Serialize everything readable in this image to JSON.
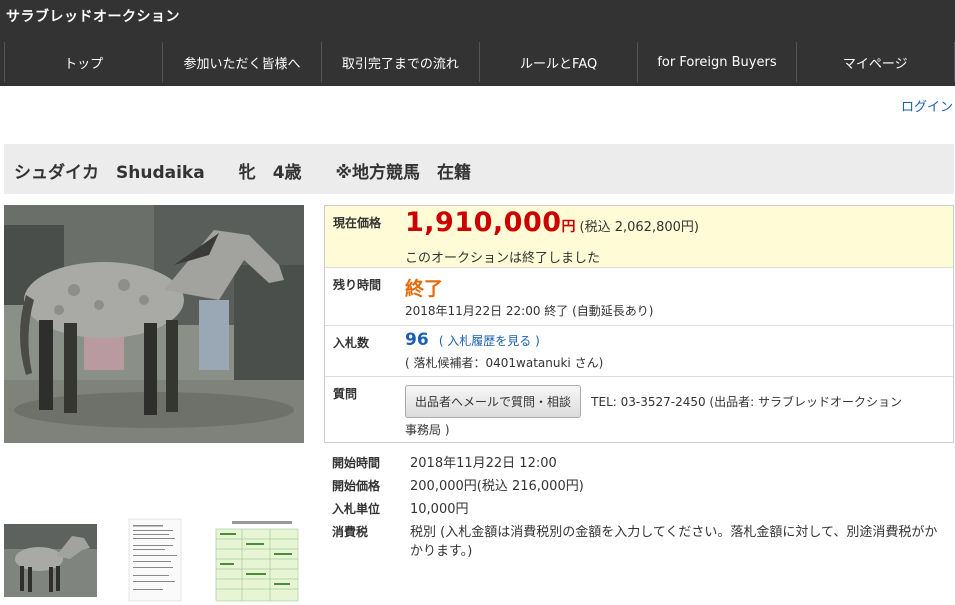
{
  "header": {
    "site_title": "サラブレッドオークション",
    "nav": [
      "トップ",
      "参加いただく皆様へ",
      "取引完了までの流れ",
      "ルールとFAQ",
      "for Foreign Buyers",
      "マイページ"
    ],
    "login": "ログイン"
  },
  "item": {
    "title": "シュダイカ　Shudaika　　牝　4歳　　※地方競馬　在籍"
  },
  "auction": {
    "price_label": "現在価格",
    "price": "1,910,000",
    "price_unit": "円",
    "price_tax": "(税込 2,062,800円)",
    "ended_message": "このオークションは終了しました",
    "remaining_label": "残り時間",
    "remaining_value": "終了",
    "end_time": "2018年11月22日 22:00 終了 (自動延長あり)",
    "bids_label": "入札数",
    "bids_count": "96",
    "bid_history_link": "( 入札履歴を見る )",
    "winner": "( 落札候補者：0401watanuki さん)",
    "question_label": "質問",
    "mail_button": "出品者へメールで質問・相談",
    "tel_text": "TEL: 03-3527-2450 (出品者:  サラブレッドオークション",
    "tel_text_2": "事務局 )"
  },
  "details": [
    {
      "label": "開始時間",
      "value": "2018年11月22日 12:00"
    },
    {
      "label": "開始価格",
      "value": "200,000円(税込 216,000円)"
    },
    {
      "label": "入札単位",
      "value": "10,000円"
    },
    {
      "label": "消費税",
      "value": "税別 (入札金額は消費税別の金額を入力してください。落札金額に対して、別途消費税がかかります。)"
    }
  ],
  "colors": {
    "header_bg": "#333333",
    "price_red": "#cc0000",
    "ended_orange": "#e36c09",
    "link_blue": "#1a5fb4",
    "price_box_bg": "#fffbd6"
  }
}
